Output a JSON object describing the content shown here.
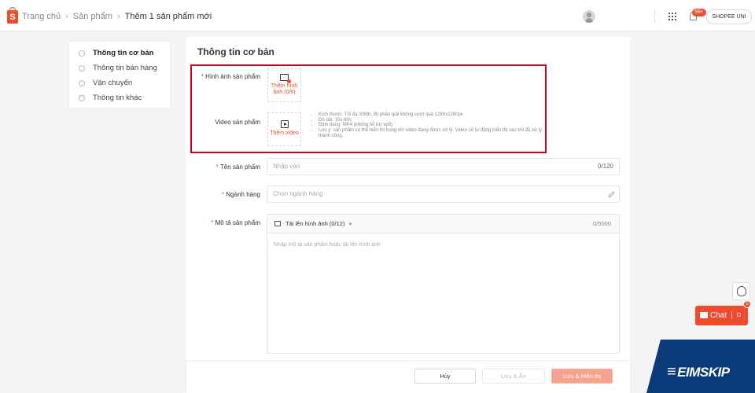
{
  "topbar": {
    "breadcrumb": [
      "Trang chủ",
      "Sản phẩm",
      "Thêm 1 sản phẩm mới"
    ],
    "badge": "99+",
    "shop_label": "SHOPEE UNI"
  },
  "leftnav": {
    "items": [
      {
        "label": "Thông tin cơ bản"
      },
      {
        "label": "Thông tin bán hàng"
      },
      {
        "label": "Vận chuyển"
      },
      {
        "label": "Thông tin khác"
      }
    ]
  },
  "form": {
    "title": "Thông tin cơ bản",
    "image": {
      "label": "Hình ảnh sản phẩm",
      "button": "Thêm hình ảnh (0/9)"
    },
    "video": {
      "label": "Video sản phẩm",
      "button": "Thêm video",
      "rules": [
        "Kích thước: Tối đa 30Mb, độ phân giải không vượt quá 1280x1280px",
        "Độ dài: 10s-60s",
        "Định dạng: MP4 (không hỗ trợ vp9)",
        "Lưu ý: sản phẩm có thể hiển thị trong khi video đang được xử lý. Video sẽ tự động hiển thị sau khi đã xử lý thành công."
      ]
    },
    "name": {
      "label": "Tên sản phẩm",
      "placeholder": "Nhập vào",
      "count": "0/120"
    },
    "category": {
      "label": "Ngành hàng",
      "placeholder": "Chọn ngành hàng"
    },
    "description": {
      "label": "Mô tả sản phẩm",
      "upload_label": "Tải lên hình ảnh (0/12)",
      "count": "0/5000",
      "placeholder": "Nhập mô tả sản phẩm hoặc tải lên hình ảnh"
    }
  },
  "footer": {
    "cancel": "Hủy",
    "save_hide": "Lưu & Ẩn",
    "save_show": "Lưu & Hiển thị"
  },
  "floating": {
    "chat_label": "Chat",
    "chat_badge": "5"
  },
  "watermark": "EIMSKIP",
  "colors": {
    "accent": "#ee4d2d",
    "highlight_box": "#d0021b",
    "watermark_bg": "#0a3b78"
  }
}
